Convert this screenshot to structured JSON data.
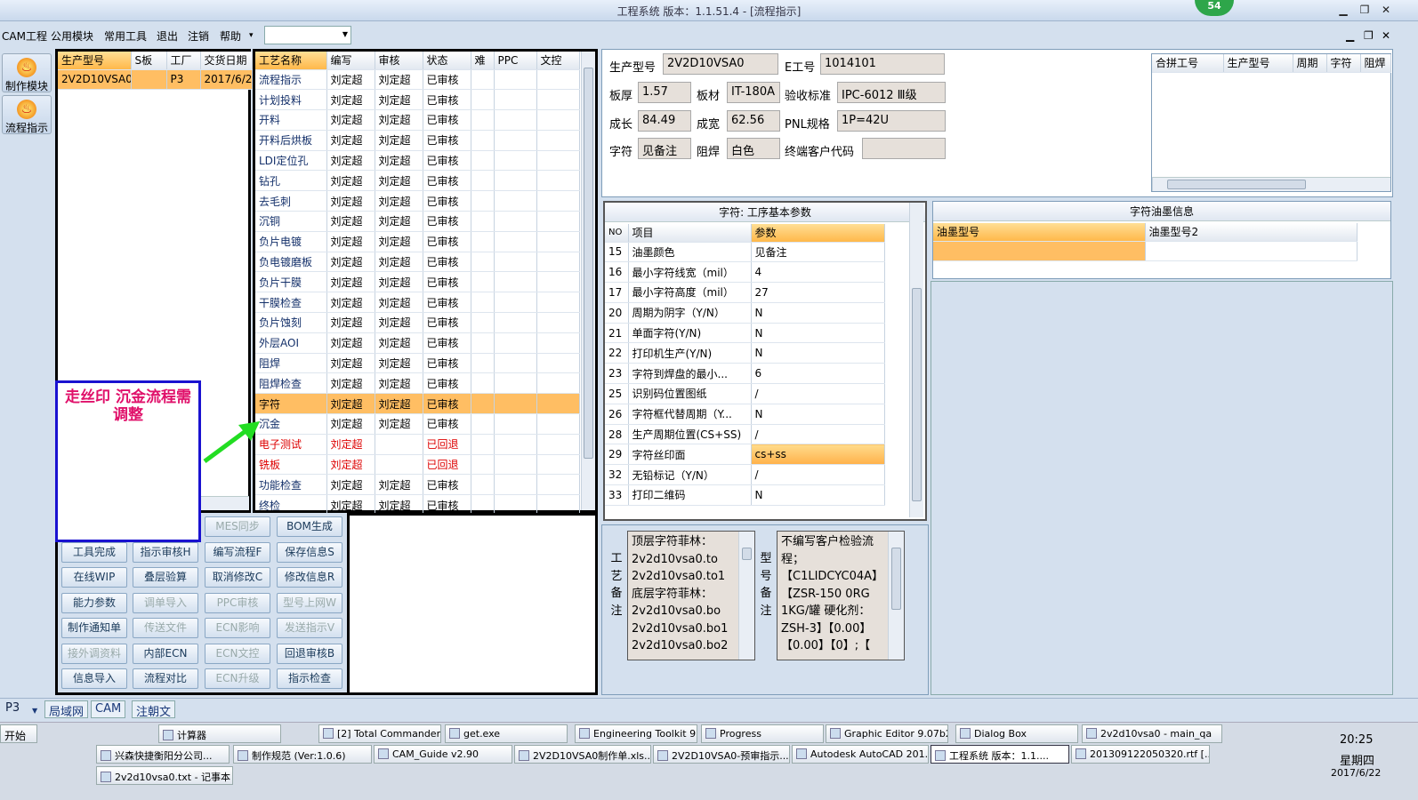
{
  "window": {
    "title": "工程系统  版本：1.1.51.4 - [流程指示]",
    "badge": "54",
    "min": "▁",
    "max": "❐",
    "close": "✕",
    "child_min": "▁",
    "child_max": "❐",
    "child_close": "✕"
  },
  "menu": [
    "CAM工程",
    "公用模块",
    "常用工具",
    "退出",
    "注销",
    "帮助"
  ],
  "menu_more": "▾",
  "combo_value": "",
  "left_nav": [
    {
      "label": "制作模块"
    },
    {
      "label": "流程指示"
    }
  ],
  "orders": {
    "headers": [
      "生产型号",
      "S板",
      "工厂",
      "交货日期"
    ],
    "rows": [
      [
        "2V2D10VSA0",
        "",
        "P3",
        "2017/6/2"
      ]
    ]
  },
  "process": {
    "headers": [
      "工艺名称",
      "编写",
      "审核",
      "状态",
      "难",
      "PPC",
      "文控"
    ],
    "rows": [
      [
        "流程指示",
        "刘定超",
        "刘定超",
        "已审核"
      ],
      [
        "计划投料",
        "刘定超",
        "刘定超",
        "已审核"
      ],
      [
        "开料",
        "刘定超",
        "刘定超",
        "已审核"
      ],
      [
        "开料后烘板",
        "刘定超",
        "刘定超",
        "已审核"
      ],
      [
        "LDI定位孔",
        "刘定超",
        "刘定超",
        "已审核"
      ],
      [
        "钻孔",
        "刘定超",
        "刘定超",
        "已审核"
      ],
      [
        "去毛刺",
        "刘定超",
        "刘定超",
        "已审核"
      ],
      [
        "沉铜",
        "刘定超",
        "刘定超",
        "已审核"
      ],
      [
        "负片电镀",
        "刘定超",
        "刘定超",
        "已审核"
      ],
      [
        "负电镀磨板",
        "刘定超",
        "刘定超",
        "已审核"
      ],
      [
        "负片干膜",
        "刘定超",
        "刘定超",
        "已审核"
      ],
      [
        "干膜检查",
        "刘定超",
        "刘定超",
        "已审核"
      ],
      [
        "负片蚀刻",
        "刘定超",
        "刘定超",
        "已审核"
      ],
      [
        "外层AOI",
        "刘定超",
        "刘定超",
        "已审核"
      ],
      [
        "阻焊",
        "刘定超",
        "刘定超",
        "已审核"
      ],
      [
        "阻焊检查",
        "刘定超",
        "刘定超",
        "已审核"
      ],
      [
        "字符",
        "刘定超",
        "刘定超",
        "已审核"
      ],
      [
        "沉金",
        "刘定超",
        "刘定超",
        "已审核"
      ],
      [
        "电子测试",
        "刘定超",
        "",
        "已回退"
      ],
      [
        "铣板",
        "刘定超",
        "",
        "已回退"
      ],
      [
        "功能检查",
        "刘定超",
        "刘定超",
        "已审核"
      ],
      [
        "终检",
        "刘定超",
        "刘定超",
        "已审核"
      ]
    ]
  },
  "info": {
    "prod_model_label": "生产型号",
    "prod_model": "2V2D10VSA0",
    "e_label": "E工号",
    "e_no": "1014101",
    "thick_label": "板厚",
    "thick": "1.57",
    "mat_label": "板材",
    "mat": "IT-180A",
    "std_label": "验收标准",
    "std": "IPC-6012 Ⅲ级",
    "len_label": "成长",
    "len": "84.49",
    "wid_label": "成宽",
    "wid": "62.56",
    "pnl_label": "PNL规格",
    "pnl": "1P=42U",
    "char_label": "字符",
    "char": "见备注",
    "mask_label": "阻焊",
    "mask": "白色",
    "cust_label": "终端客户代码",
    "cust": ""
  },
  "merge": {
    "headers": [
      "合拼工号",
      "生产型号",
      "周期",
      "字符",
      "阻焊"
    ]
  },
  "params": {
    "title": "字符: 工序基本参数",
    "headers": [
      "NO",
      "项目",
      "参数"
    ],
    "rows": [
      [
        "15",
        "油墨颜色",
        "见备注"
      ],
      [
        "16",
        "最小字符线宽（mil）",
        "4"
      ],
      [
        "17",
        "最小字符高度（mil）",
        "27"
      ],
      [
        "20",
        "周期为阴字（Y/N）",
        "N"
      ],
      [
        "21",
        "单面字符(Y/N)",
        "N"
      ],
      [
        "22",
        "打印机生产(Y/N)",
        "N"
      ],
      [
        "23",
        "字符到焊盘的最小...",
        "6"
      ],
      [
        "25",
        "识别码位置图纸",
        "/"
      ],
      [
        "26",
        "字符框代替周期（Y...",
        "N"
      ],
      [
        "28",
        "生产周期位置(CS+SS)",
        "/"
      ],
      [
        "29",
        "字符丝印面",
        "cs+ss"
      ],
      [
        "32",
        "无铅标记（Y/N）",
        "/"
      ],
      [
        "33",
        "打印二维码",
        "N"
      ]
    ]
  },
  "ink": {
    "title": "字符油墨信息",
    "headers": [
      "油墨型号",
      "油墨型号2"
    ]
  },
  "buttons": [
    [
      "",
      "",
      "MES同步",
      "BOM生成"
    ],
    [
      "工具完成",
      "指示审核H",
      "编写流程F",
      "保存信息S"
    ],
    [
      "在线WIP",
      "叠层验算",
      "取消修改C",
      "修改信息R"
    ],
    [
      "能力参数",
      "调单导入",
      "PPC审核",
      "型号上网W"
    ],
    [
      "制作通知单",
      "传送文件",
      "ECN影响",
      "发送指示V"
    ],
    [
      "接外调资料",
      "内部ECN",
      "ECN文控",
      "回退审核B"
    ],
    [
      "信息导入",
      "流程对比",
      "ECN升级",
      "指示检查"
    ]
  ],
  "annotation": "走丝印  沉金流程需调整",
  "notes": {
    "craft_label": [
      "工",
      "艺",
      "备",
      "注"
    ],
    "craft": [
      "顶层字符菲林：",
      "2v2d10vsa0.to",
      "2v2d10vsa0.to1",
      "底层字符菲林：",
      "2v2d10vsa0.bo",
      "2v2d10vsa0.bo1",
      "2v2d10vsa0.bo2"
    ],
    "model_label": [
      "型",
      "号",
      "备",
      "注"
    ],
    "model": [
      "不编写客户检验流",
      "程；",
      "【C1LIDCYC04A】",
      "【ZSR-150 0RG",
      "1KG/罐  硬化剂：",
      "ZSH-3】【0.00】",
      "【0.00】【0】;【"
    ]
  },
  "status": {
    "combo": "P3",
    "tabs": [
      "局域网",
      "CAM",
      "注朝文"
    ]
  },
  "taskbar": {
    "start": "开始",
    "row1": [
      "兴森快捷衡阳分公司...",
      "计算器",
      "[2] Total Commander ...",
      "get.exe",
      "Engineering Toolkit 9....",
      "Progress",
      "Graphic Editor 9.07b2...",
      "Dialog Box",
      "2v2d10vsa0 - main_qa"
    ],
    "row2": [
      "制作规范 (Ver:1.0.6)",
      "CAM_Guide v2.90",
      "2V2D10VSA0制作单.xls...",
      "2V2D10VSA0-预审指示...",
      "Autodesk AutoCAD 201...",
      "工程系统  版本：1.1....",
      "201309122050320.rtf [..."
    ],
    "row3": [
      "2v2d10vsa0.txt - 记事本"
    ],
    "time": "20:25",
    "weekday": "星期四",
    "date": "2017/6/22"
  },
  "colors": {
    "selected": "#ffbe63",
    "returned": "#dd0000",
    "annotation": "#e0106a",
    "arrow": "#22dd22"
  }
}
